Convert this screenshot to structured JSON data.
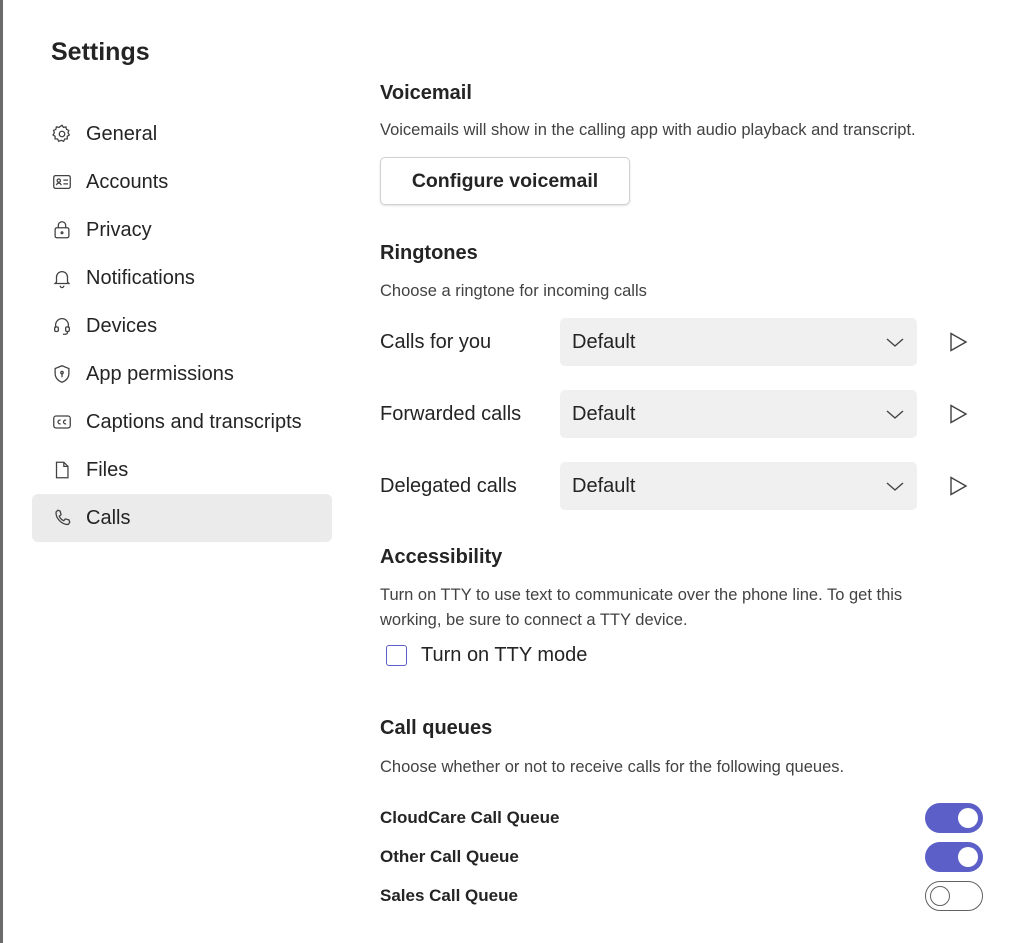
{
  "sidebar": {
    "title": "Settings",
    "items": [
      {
        "label": "General",
        "icon": "gear-icon"
      },
      {
        "label": "Accounts",
        "icon": "id-card-icon"
      },
      {
        "label": "Privacy",
        "icon": "lock-icon"
      },
      {
        "label": "Notifications",
        "icon": "bell-icon"
      },
      {
        "label": "Devices",
        "icon": "headset-icon"
      },
      {
        "label": "App permissions",
        "icon": "shield-icon"
      },
      {
        "label": "Captions and transcripts",
        "icon": "closed-captions-icon"
      },
      {
        "label": "Files",
        "icon": "file-icon"
      },
      {
        "label": "Calls",
        "icon": "phone-icon",
        "active": true
      }
    ]
  },
  "voicemail": {
    "title": "Voicemail",
    "description": "Voicemails will show in the calling app with audio playback and transcript.",
    "button_label": "Configure voicemail"
  },
  "ringtones": {
    "title": "Ringtones",
    "description": "Choose a ringtone for incoming calls",
    "rows": [
      {
        "label": "Calls for you",
        "value": "Default"
      },
      {
        "label": "Forwarded calls",
        "value": "Default"
      },
      {
        "label": "Delegated calls",
        "value": "Default"
      }
    ]
  },
  "accessibility": {
    "title": "Accessibility",
    "description_line1": "Turn on TTY to use text to communicate over the phone line. To get this",
    "description_line2": "working, be sure to connect a TTY device.",
    "checkbox_label": "Turn on TTY mode",
    "checked": false
  },
  "call_queues": {
    "title": "Call queues",
    "description": "Choose whether or not to receive calls for the following queues.",
    "queues": [
      {
        "label": "CloudCare Call Queue",
        "enabled": true
      },
      {
        "label": "Other Call Queue",
        "enabled": true
      },
      {
        "label": "Sales Call Queue",
        "enabled": false
      }
    ]
  },
  "colors": {
    "accent": "#5b5fc7",
    "active_nav_bg": "#ebebeb",
    "dropdown_bg": "#f0f0f0"
  }
}
